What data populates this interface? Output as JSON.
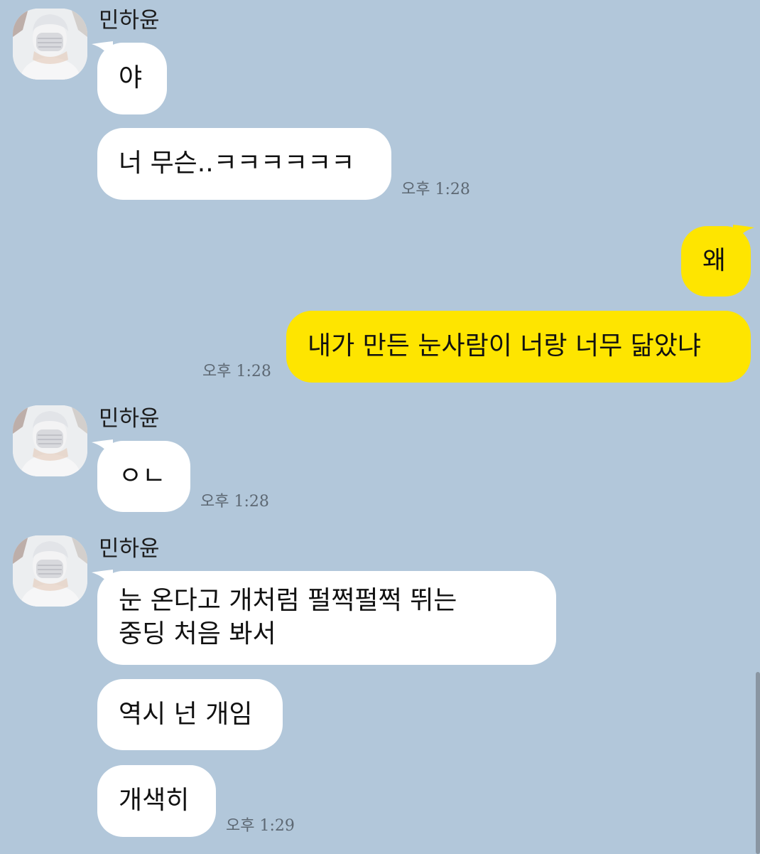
{
  "chat": {
    "partner_name": "민하윤",
    "messages": [
      {
        "text": "야"
      },
      {
        "text": "너 무슨..ㅋㅋㅋㅋㅋㅋ",
        "time": "오후 1:28"
      },
      {
        "text": "왜"
      },
      {
        "text": "내가 만든 눈사람이 너랑 너무 닮았냐",
        "time": "오후 1:28"
      },
      {
        "text": "ㅇㄴ",
        "time": "오후 1:28"
      },
      {
        "line1": "눈 온다고 개처럼 펄쩍펄쩍 뛰는",
        "line2": "중딩 처음 봐서"
      },
      {
        "text": "역시 넌 개임"
      },
      {
        "text": "개색히",
        "time": "오후 1:29"
      }
    ]
  },
  "colors": {
    "background": "#b2c7da",
    "incoming_bubble": "#ffffff",
    "outgoing_bubble": "#fee500"
  },
  "icons": {
    "avatar": "profile-photo-icon",
    "incoming_tail": "bubble-tail-left-icon",
    "outgoing_tail": "bubble-tail-right-icon"
  }
}
